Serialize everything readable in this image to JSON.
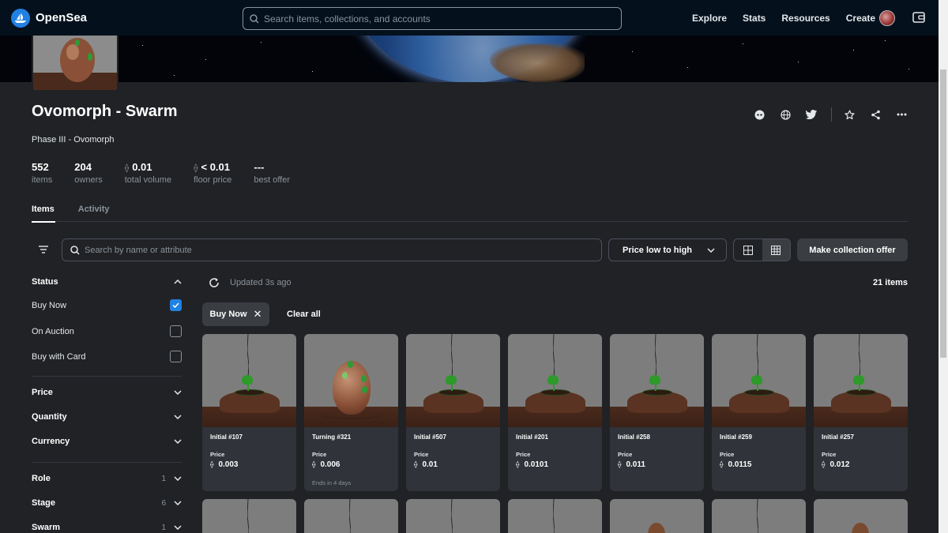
{
  "nav": {
    "brand": "OpenSea",
    "search_placeholder": "Search items, collections, and accounts",
    "links": [
      "Explore",
      "Stats",
      "Resources",
      "Create"
    ]
  },
  "collection": {
    "title": "Ovomorph - Swarm",
    "subtitle": "Phase III - Ovomorph",
    "stats": [
      {
        "value": "552",
        "label": "items",
        "eth": false
      },
      {
        "value": "204",
        "label": "owners",
        "eth": false
      },
      {
        "value": "0.01",
        "label": "total volume",
        "eth": true
      },
      {
        "value": "< 0.01",
        "label": "floor price",
        "eth": true
      },
      {
        "value": "---",
        "label": "best offer",
        "eth": false
      }
    ]
  },
  "tabs": [
    "Items",
    "Activity"
  ],
  "toolbar": {
    "search_placeholder": "Search by name or attribute",
    "sort_label": "Price low to high",
    "offer_label": "Make collection offer"
  },
  "sidebar": {
    "status_title": "Status",
    "status_options": [
      {
        "label": "Buy Now",
        "checked": true
      },
      {
        "label": "On Auction",
        "checked": false
      },
      {
        "label": "Buy with Card",
        "checked": false
      }
    ],
    "sections": [
      "Price",
      "Quantity",
      "Currency"
    ],
    "traits": [
      {
        "label": "Role",
        "count": "1"
      },
      {
        "label": "Stage",
        "count": "6"
      },
      {
        "label": "Swarm",
        "count": "1"
      }
    ]
  },
  "results": {
    "updated": "Updated 3s ago",
    "count": "21 items",
    "chip": "Buy Now",
    "clear": "Clear all"
  },
  "cards": [
    {
      "name": "Initial #107",
      "price_label": "Price",
      "price": "0.003",
      "ends": "",
      "art": "sprout"
    },
    {
      "name": "Turning #321",
      "price_label": "Price",
      "price": "0.006",
      "ends": "Ends in 4 days",
      "art": "egg"
    },
    {
      "name": "Initial #507",
      "price_label": "Price",
      "price": "0.01",
      "ends": "",
      "art": "sprout"
    },
    {
      "name": "Initial #201",
      "price_label": "Price",
      "price": "0.0101",
      "ends": "",
      "art": "sprout"
    },
    {
      "name": "Initial #258",
      "price_label": "Price",
      "price": "0.011",
      "ends": "",
      "art": "sprout"
    },
    {
      "name": "Initial #259",
      "price_label": "Price",
      "price": "0.0115",
      "ends": "",
      "art": "sprout"
    },
    {
      "name": "Initial #257",
      "price_label": "Price",
      "price": "0.012",
      "ends": "",
      "art": "sprout"
    }
  ],
  "partial_cards": [
    "crack",
    "crack",
    "crack",
    "crack",
    "creature",
    "crack",
    "creature"
  ],
  "colors": {
    "accent": "#2081e2",
    "nav_bg": "#04111d",
    "page_bg": "#202225",
    "card_bg": "#303339"
  }
}
